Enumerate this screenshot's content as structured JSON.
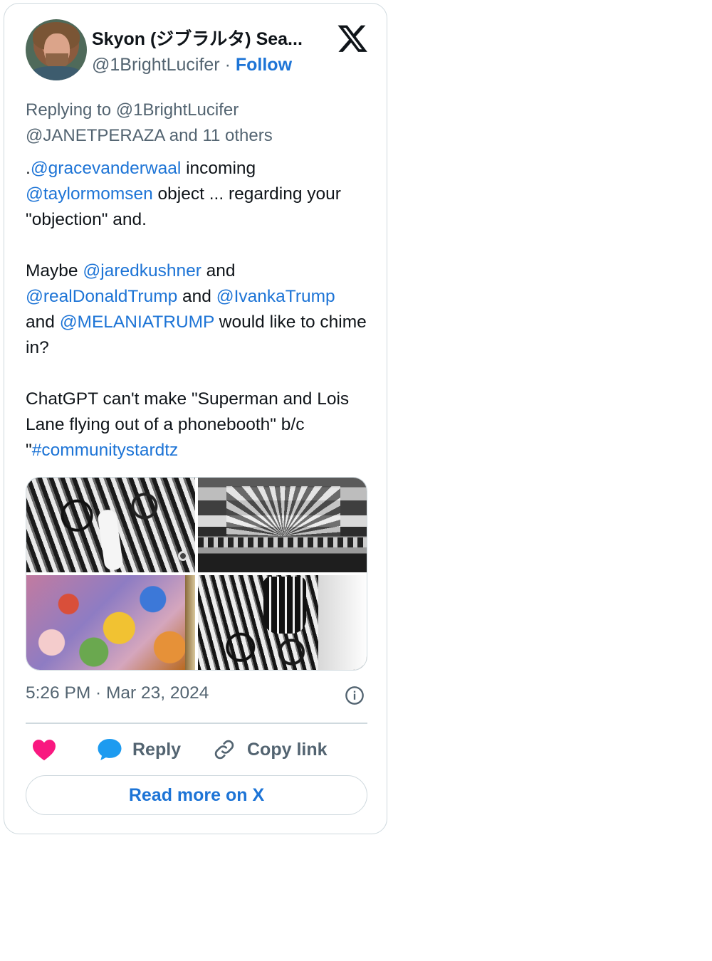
{
  "author": {
    "display_name": "Skyon (ジブラルタ) Sea...",
    "handle": "@1BrightLucifer",
    "separator": "·",
    "follow_label": "Follow"
  },
  "tweet": {
    "replying_to_line1": "Replying to @1BrightLucifer",
    "replying_to_line2": "@JANETPERAZA and 11 others",
    "p1": {
      "prefix": ".",
      "mention1": "@gracevanderwaal",
      "t1": " incoming ",
      "mention2": "@taylormomsen",
      "t2": " object ... regarding your \"objection\" and."
    },
    "p2": {
      "t0": "Maybe ",
      "mention1": "@jaredkushner",
      "t1": " and ",
      "mention2": "@realDonaldTrump",
      "t2": " and ",
      "mention3": "@IvankaTrump",
      "t3": " and ",
      "mention4": "@MELANIATRUMP",
      "t4": " would like to chime in?"
    },
    "p3": {
      "t0": "ChatGPT can't make \"Superman and Lois Lane flying out of a phonebooth\" b/c \"",
      "hashtag": "#communitystardtz"
    },
    "timestamp": "5:26 PM · Mar 23, 2024"
  },
  "actions": {
    "reply_label": "Reply",
    "copy_link_label": "Copy link",
    "read_more_label": "Read more on X"
  },
  "colors": {
    "link": "#1d74d6",
    "muted": "#536471",
    "heart": "#f91880",
    "reply_bubble": "#1d9bf0",
    "border": "#cfd9de"
  },
  "icons": [
    "x-logo-icon",
    "info-icon",
    "heart-icon",
    "speech-bubble-icon",
    "link-icon"
  ]
}
